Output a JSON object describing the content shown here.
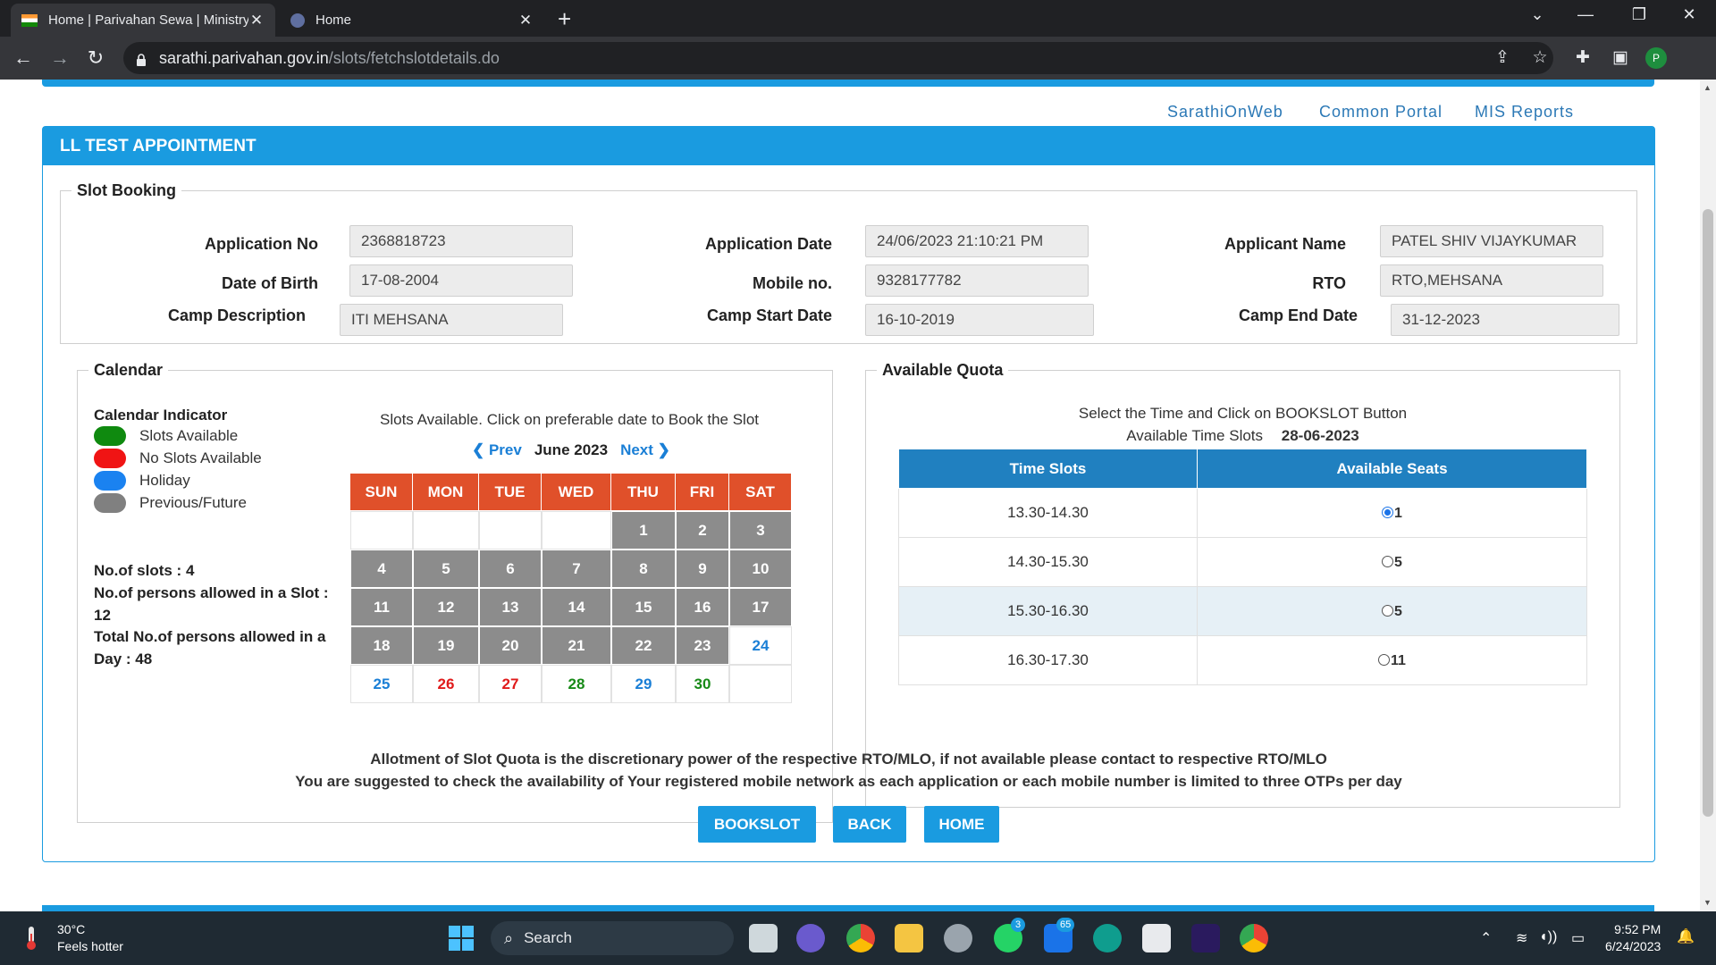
{
  "browser": {
    "tabs": [
      {
        "title": "Home | Parivahan Sewa | Ministry of Road Transport",
        "active": true
      },
      {
        "title": "Home",
        "active": false
      }
    ],
    "url_host": "sarathi.parivahan.gov.in",
    "url_path": "/slots/fetchslotdetails.do",
    "profile_initial": "P"
  },
  "header_links": [
    "SarathiOnWeb",
    "Common Portal",
    "MIS Reports"
  ],
  "panel_title": "LL TEST APPOINTMENT",
  "slot_booking": {
    "legend": "Slot Booking",
    "fields": {
      "application_no": {
        "label": "Application No",
        "value": "2368818723"
      },
      "application_date": {
        "label": "Application Date",
        "value": "24/06/2023 21:10:21 PM"
      },
      "applicant_name": {
        "label": "Applicant Name",
        "value": "PATEL SHIV VIJAYKUMAR"
      },
      "dob": {
        "label": "Date of Birth",
        "value": "17-08-2004"
      },
      "mobile": {
        "label": "Mobile no.",
        "value": "9328177782"
      },
      "rto": {
        "label": "RTO",
        "value": "RTO,MEHSANA"
      },
      "camp_description": {
        "label": "Camp Description",
        "value": "ITI MEHSANA"
      },
      "camp_start": {
        "label": "Camp Start Date",
        "value": "16-10-2019"
      },
      "camp_end": {
        "label": "Camp End Date",
        "value": "31-12-2023"
      }
    }
  },
  "calendar": {
    "legend": "Calendar",
    "indicator_title": "Calendar Indicator",
    "indicators": [
      {
        "label": "Slots Available",
        "color": "#0f8a0f"
      },
      {
        "label": "No Slots Available",
        "color": "#f01414"
      },
      {
        "label": "Holiday",
        "color": "#1a82f0"
      },
      {
        "label": "Previous/Future",
        "color": "#808080"
      }
    ],
    "slots_line": "No.of slots : 4",
    "persons_slot_line": "No.of persons allowed in a Slot : 12",
    "persons_day_line": "Total No.of persons allowed in a Day : 48",
    "caption": "Slots Available. Click on preferable date to Book the Slot",
    "prev_label": "Prev",
    "next_label": "Next",
    "month_label": "June 2023",
    "weekdays": [
      "SUN",
      "MON",
      "TUE",
      "WED",
      "THU",
      "FRI",
      "SAT"
    ],
    "weeks": [
      [
        {
          "d": "",
          "s": "empty"
        },
        {
          "d": "",
          "s": "empty"
        },
        {
          "d": "",
          "s": "empty"
        },
        {
          "d": "",
          "s": "empty"
        },
        {
          "d": "1",
          "s": "grey"
        },
        {
          "d": "2",
          "s": "grey"
        },
        {
          "d": "3",
          "s": "grey"
        }
      ],
      [
        {
          "d": "4",
          "s": "grey"
        },
        {
          "d": "5",
          "s": "grey"
        },
        {
          "d": "6",
          "s": "grey"
        },
        {
          "d": "7",
          "s": "grey"
        },
        {
          "d": "8",
          "s": "grey"
        },
        {
          "d": "9",
          "s": "grey"
        },
        {
          "d": "10",
          "s": "grey"
        }
      ],
      [
        {
          "d": "11",
          "s": "grey"
        },
        {
          "d": "12",
          "s": "grey"
        },
        {
          "d": "13",
          "s": "grey"
        },
        {
          "d": "14",
          "s": "grey"
        },
        {
          "d": "15",
          "s": "grey"
        },
        {
          "d": "16",
          "s": "grey"
        },
        {
          "d": "17",
          "s": "grey"
        }
      ],
      [
        {
          "d": "18",
          "s": "grey"
        },
        {
          "d": "19",
          "s": "grey"
        },
        {
          "d": "20",
          "s": "grey"
        },
        {
          "d": "21",
          "s": "grey"
        },
        {
          "d": "22",
          "s": "grey"
        },
        {
          "d": "23",
          "s": "grey"
        },
        {
          "d": "24",
          "s": "holiday"
        }
      ],
      [
        {
          "d": "25",
          "s": "holiday"
        },
        {
          "d": "26",
          "s": "nosl"
        },
        {
          "d": "27",
          "s": "nosl"
        },
        {
          "d": "28",
          "s": "avail"
        },
        {
          "d": "29",
          "s": "holiday"
        },
        {
          "d": "30",
          "s": "avail"
        },
        {
          "d": "",
          "s": "empty"
        }
      ]
    ]
  },
  "quota": {
    "legend": "Available Quota",
    "instruction": "Select the Time and Click on BOOKSLOT Button",
    "available_label": "Available Time Slots",
    "selected_date": "28-06-2023",
    "headers": [
      "Time Slots",
      "Available Seats"
    ],
    "rows": [
      {
        "time": "13.30-14.30",
        "seats": "1",
        "selected": true
      },
      {
        "time": "14.30-15.30",
        "seats": "5",
        "selected": false
      },
      {
        "time": "15.30-16.30",
        "seats": "5",
        "selected": false
      },
      {
        "time": "16.30-17.30",
        "seats": "11",
        "selected": false
      }
    ]
  },
  "notes": [
    "Allotment of Slot Quota is the discretionary power of the respective RTO/MLO, if not available please contact to respective RTO/MLO",
    "You are suggested to check the availability of Your registered mobile network as each application or each mobile number is limited to three OTPs per day"
  ],
  "buttons": {
    "bookslot": "BOOKSLOT",
    "back": "BACK",
    "home": "HOME"
  },
  "taskbar": {
    "temperature": "30°C",
    "weather_text": "Feels hotter",
    "search_label": "Search",
    "badges": {
      "whatsapp": "3",
      "mail": "65"
    },
    "time": "9:52 PM",
    "date": "6/24/2023"
  },
  "colors": {
    "accent": "#1a9be0",
    "calendar_header": "#e0502a",
    "quota_header": "#2080c0"
  }
}
